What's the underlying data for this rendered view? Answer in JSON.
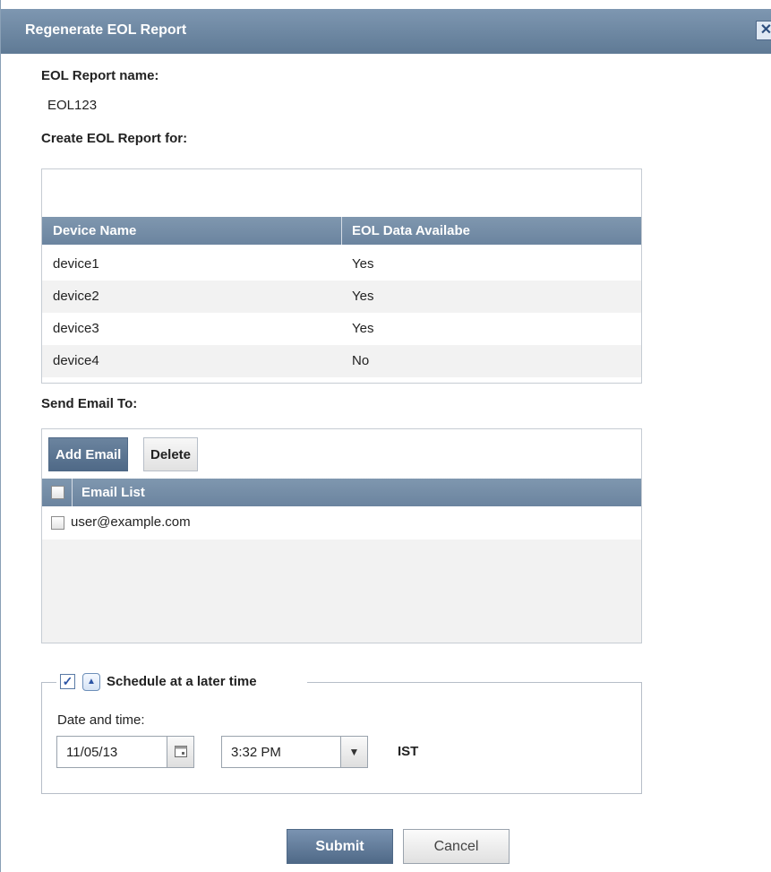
{
  "dialog": {
    "title": "Regenerate EOL Report",
    "close_symbol": "✕"
  },
  "report_name": {
    "label": "EOL Report name:",
    "value": "EOL123"
  },
  "create_for": {
    "label": "Create EOL Report for:"
  },
  "device_grid": {
    "columns": [
      "Device Name",
      "EOL Data Availabe"
    ],
    "rows": [
      {
        "name": "device1",
        "eol": "Yes"
      },
      {
        "name": "device2",
        "eol": "Yes"
      },
      {
        "name": "device3",
        "eol": "Yes"
      },
      {
        "name": "device4",
        "eol": "No"
      }
    ]
  },
  "email": {
    "label": "Send Email To:",
    "add_label": "Add Email",
    "delete_label": "Delete",
    "column": "Email List",
    "items": [
      "user@example.com"
    ]
  },
  "schedule": {
    "legend": "Schedule at a later time",
    "checked": true,
    "date_label": "Date and time:",
    "date_value": "11/05/13",
    "time_value": "3:32 PM",
    "timezone": "IST"
  },
  "actions": {
    "submit_label": "Submit",
    "cancel_label": "Cancel"
  },
  "colors": {
    "header_blue": "#6b849f",
    "primary_button": "#4f6987"
  },
  "icons": [
    "close-icon",
    "calendar-icon",
    "chevron-down-icon",
    "chevron-up-icon",
    "checkmark-icon"
  ]
}
